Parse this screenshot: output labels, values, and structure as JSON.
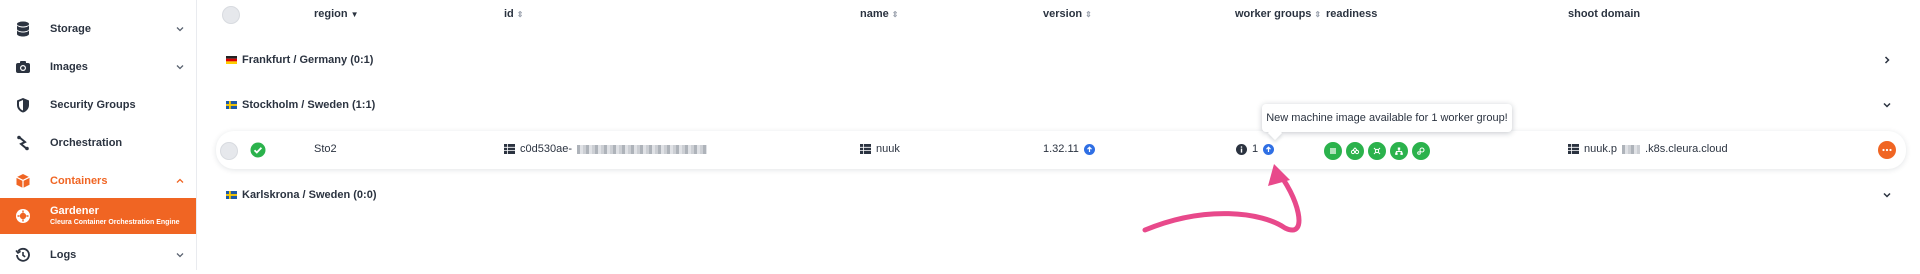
{
  "sidebar": {
    "items": [
      {
        "label": "Storage"
      },
      {
        "label": "Images"
      },
      {
        "label": "Security Groups"
      },
      {
        "label": "Orchestration"
      },
      {
        "label": "Containers"
      },
      {
        "label": "Gardener",
        "sub": "Cleura Container Orchestration Engine"
      },
      {
        "label": "Logs"
      }
    ]
  },
  "table": {
    "headers": {
      "region": "region",
      "id": "id",
      "name": "name",
      "version": "version",
      "worker_groups": "worker groups",
      "readiness": "readiness",
      "shoot_domain": "shoot domain"
    },
    "groups": [
      {
        "label": "Frankfurt / Germany (0:1)"
      },
      {
        "label": "Stockholm / Sweden (1:1)"
      },
      {
        "label": "Karlskrona / Sweden (0:0)"
      }
    ],
    "cluster": {
      "region": "Sto2",
      "id_prefix": "c0d530ae-",
      "name": "nuuk",
      "version": "1.32.11",
      "worker_groups": "1",
      "domain_prefix": "nuuk.p",
      "domain_suffix": ".k8s.cleura.cloud"
    }
  },
  "tooltip": {
    "text": "New machine image available for 1 worker group!"
  },
  "colors": {
    "accent": "#f06523",
    "ok": "#2bb24c",
    "info": "#2f6fe4",
    "arrow": "#e8498b"
  }
}
